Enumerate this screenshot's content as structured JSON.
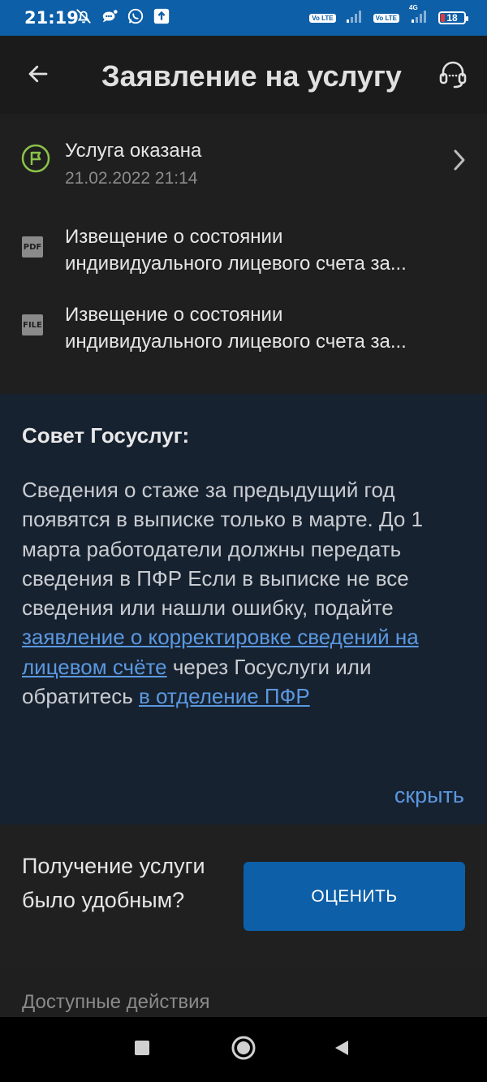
{
  "status_bar": {
    "time": "21:19",
    "left_icons": [
      "bell-off-icon",
      "chat-bubble-icon",
      "whatsapp-icon",
      "upload-icon"
    ],
    "sim1_label": "Vo LTE",
    "sim2_label": "Vo LTE",
    "network_label": "4G",
    "battery": "18",
    "battery_level": 18,
    "battery_color": "#e53935"
  },
  "app_bar": {
    "title": "Заявление на услугу",
    "back_icon": "arrow-left-icon",
    "support_icon": "headset-icon"
  },
  "status": {
    "title": "Услуга оказана",
    "date": "21.02.2022 21:14",
    "icon": "flag-icon",
    "icon_color": "#8bc34a"
  },
  "documents": [
    {
      "type": "PDF",
      "line1": "Извещение о состоянии",
      "line2": "индивидуального лицевого счета за..."
    },
    {
      "type": "FILE",
      "line1": "Извещение о состоянии",
      "line2": "индивидуального лицевого счета за..."
    }
  ],
  "tip": {
    "title": "Совет Госуслуг:",
    "text_1": "Сведения о стаже за предыдущий год появятся в выписке только в марте. До 1 марта работодатели должны передать сведения в ПФР Если в выписке не все сведения или нашли ошибку, подайте ",
    "link_1": "заявление о корректировке сведений на лицевом счёте",
    "text_2": " через Госуслуги или обратитесь ",
    "link_2": "в отделение ПФР",
    "hide_label": "скрыть"
  },
  "rating": {
    "question": "Получение услуги было удобным?",
    "button_label": "ОЦЕНИТЬ"
  },
  "actions": {
    "title": "Доступные действия"
  },
  "colors": {
    "accent": "#0d5fa8",
    "link": "#5a98e0",
    "tip_background": "#172230",
    "background": "#1f1f1f"
  }
}
